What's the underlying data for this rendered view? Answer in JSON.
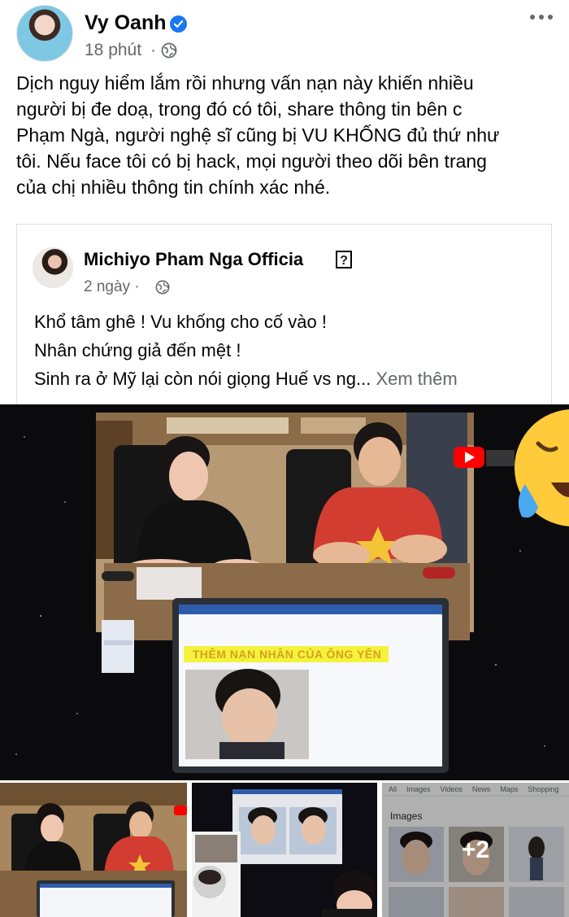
{
  "post": {
    "author": "Vy Oanh",
    "time": "18 phút",
    "separator": "·",
    "lines": [
      "Dịch nguy hiểm lắm rồi nhưng vấn nạn này khiến nhiều",
      "người bị đe doạ, trong đó có tôi, share thông tin bên c",
      "Phạm Ngà, người nghệ sĩ cũng bị VU KHỐNG đủ thứ như",
      "tôi. Nếu face tôi có bị hack, mọi người theo dõi bên trang",
      "của chị nhiều thông tin chính xác nhé."
    ]
  },
  "shared": {
    "author": "Michiyo Pham Nga Officia",
    "unknown_glyph": "?",
    "time": "2 ngày",
    "separator": "·",
    "lines": [
      "Khổ tâm ghê ! Vu khống cho cố vào !",
      "Nhân chứng giả đến mệt !",
      "Sinh ra ở Mỹ lại còn nói giọng Huế vs ng..."
    ],
    "see_more": "Xem thêm"
  },
  "media": {
    "screen_caption": "THÊM NẠN NHÂN CỦA ÔNG YÊN",
    "more_count": "+2",
    "search_tabs": [
      "All",
      "Images",
      "Videos",
      "News",
      "Maps",
      "Shopping"
    ],
    "search_images_label": "Images"
  },
  "colors": {
    "verified": "#1877f2",
    "secondary_text": "#65676b",
    "youtube_red": "#ff0000"
  },
  "icons": [
    "verified-badge-icon",
    "globe-icon",
    "more-options-icon",
    "laughing-crying-emoji",
    "youtube-logo-icon"
  ]
}
